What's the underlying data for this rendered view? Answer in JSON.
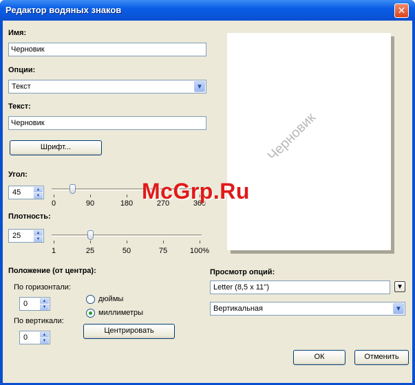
{
  "window": {
    "title": "Редактор водяных знаков",
    "close_glyph": "✕"
  },
  "name": {
    "label": "Имя:",
    "value": "Черновик"
  },
  "options": {
    "label": "Опции:",
    "selected": "Текст"
  },
  "text": {
    "label": "Текст:",
    "value": "Черновик"
  },
  "font_button": "Шрифт...",
  "angle": {
    "label": "Угол:",
    "value": "45",
    "ticks": [
      "0",
      "90",
      "180",
      "270",
      "360"
    ],
    "slider_level": 45,
    "slider_max": 360
  },
  "density": {
    "label": "Плотность:",
    "value": "25",
    "ticks": [
      "1",
      "25",
      "50",
      "75",
      "100%"
    ],
    "slider_level": 25,
    "slider_max": 100
  },
  "position": {
    "label": "Положение (от центра):",
    "horizontal_label": "По горизонтали:",
    "horizontal_value": "0",
    "vertical_label": "По вертикали:",
    "vertical_value": "0",
    "unit_inches": "дюймы",
    "unit_mm": "миллиметры",
    "selected_unit": "миллиметры",
    "center_button": "Центрировать"
  },
  "preview": {
    "watermark_text": "Черновик"
  },
  "preview_options": {
    "label": "Просмотр опций:",
    "paper": "Letter (8,5 x 11'')",
    "orientation": "Вертикальная"
  },
  "buttons": {
    "ok": "ОК",
    "cancel": "Отменить"
  },
  "overlay_watermark": "McGrp.Ru",
  "colors": {
    "titlebar": "#0a5ee6",
    "dialog_bg": "#ece9d8",
    "overlay": "#e01a1a"
  }
}
